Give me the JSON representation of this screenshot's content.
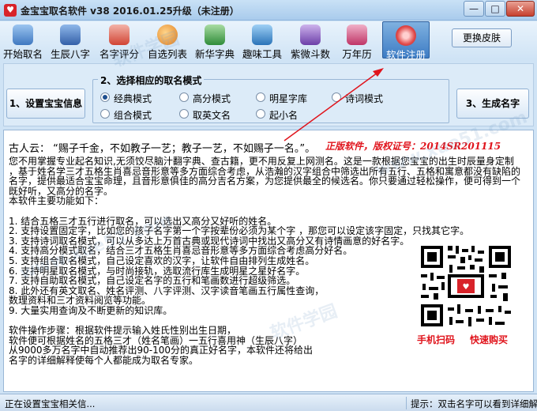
{
  "window": {
    "title": "金宝宝取名软件 v38  2016.01.25升级（未注册）",
    "app_icon_glyph": "♥",
    "min_glyph": "—",
    "max_glyph": "□",
    "close_glyph": "✕"
  },
  "toolbar": {
    "items": [
      {
        "label": "开始取名",
        "icon": "people-icon",
        "color": "#5a8fd0"
      },
      {
        "label": "生辰八字",
        "icon": "calendar-person-icon",
        "color": "#3f6fb5"
      },
      {
        "label": "名字评分",
        "icon": "score-sheet-icon",
        "color": "#d94a3a"
      },
      {
        "label": "自选列表",
        "icon": "globe-list-icon",
        "color": "#e08b2a"
      },
      {
        "label": "新华字典",
        "icon": "dictionary-icon",
        "color": "#3c9a45"
      },
      {
        "label": "趣味工具",
        "icon": "tools-icon",
        "color": "#2f7fc4"
      },
      {
        "label": "紫微斗数",
        "icon": "ziwei-star-icon",
        "color": "#7a4fb0"
      },
      {
        "label": "万年历",
        "icon": "almanac-icon",
        "color": "#c23b6a"
      },
      {
        "label": "软件注册",
        "icon": "register-flower-icon",
        "color": "#e04a4a"
      }
    ],
    "skin_button": "更换皮肤"
  },
  "setup": {
    "setup_button": "1、设置宝宝信息",
    "mode_group_title": "2、选择相应的取名模式",
    "generate_button": "3、生成名字",
    "modes": [
      {
        "label": "经典模式",
        "selected": true
      },
      {
        "label": "高分模式",
        "selected": false
      },
      {
        "label": "明星字库",
        "selected": false
      },
      {
        "label": "诗词模式",
        "selected": false
      },
      {
        "label": "组合模式",
        "selected": false
      },
      {
        "label": "取英文名",
        "selected": false
      },
      {
        "label": "起小名",
        "selected": false
      }
    ]
  },
  "content": {
    "quote": "古人云：  “赐子千金，不如教子一艺；教子一艺，不如赐子一名。”。",
    "license": "正版软件，版权证号：2014SR201115",
    "lines": [
      "您不用掌握专业起名知识,无须饺尽脑汁翻字典、查古籍，更不用反复上网测名。这是一款根据您宝宝的出生时辰量身定制",
      "，基于姓名学三才五格生肖喜忌音形意等多方面综合考虑，从浩瀚的汉字组合中筛选出所有五行、五格和寓意都没有缺陷的",
      "名字，提供最适合宝宝命理，且音形意俱佳的高分吉名方案，为您提供最全的候选名。你只要通过轻松操作，便可得到一个",
      "既好听，又高分的名字。",
      "本软件主要功能如下：",
      "",
      "1. 结合五格三才五行进行取名，可以选出又高分又好听的姓名。",
      "2. 支持设置固定字，比如您的孩子名字第一个字按辈份必须为某个字 ，那您可以设定该字固定，只找其它字。",
      "3. 支持诗词取名模式，可以从多达上万首古典或现代诗词中找出又高分又有诗情画意的好名字。",
      "4. 支持高分模式取名，结合三才五格生肖喜忌音形意等多方面综合考虑高分好名。",
      "5. 支持组合取名模式，自己设定喜欢的汉字，让软件自由排列生成姓名。",
      "6. 支持明星取名模式，与时尚接轨，选取流行库生成明星之星好名字。",
      "7. 支持自助取名模式，自己设定名字的五行和笔画数进行超级筛选。",
      "8. 此外还有英文取名、姓名评测、八字评测、汉字读音笔画五行属性查询，",
      "   数理资料和三才资料阅览等功能。",
      "9. 大量实用查询及不断更新的知识库。",
      "",
      "软件操作步骤：根据软件提示输入姓氏性别出生日期，",
      "软件便可根据姓名的五格三才（姓名笔画）一五行喜用神（生辰八字）",
      "从9000多万名字中自动推荐出90-100分的真正好名字，本软件还将给出",
      "名字的详细解释使每个人都能成为取名专家。"
    ],
    "qr_caption_left": "手机扫码",
    "qr_caption_right": "快速购买"
  },
  "status": {
    "left": "正在设置宝宝相关信...",
    "right": "提示：双击名字可以看到详细解释"
  },
  "watermarks": [
    "软件学园",
    "www.xue51.com",
    "软件学园",
    "www.xue51.com"
  ]
}
